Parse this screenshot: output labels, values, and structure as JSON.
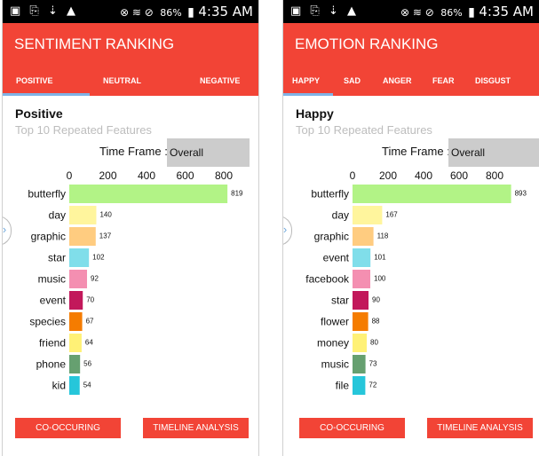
{
  "status_bar": {
    "left_icons": "▣ ⎘ ⇣ ▲",
    "right_icons": "⊗ ≋ ⊘",
    "battery": "86%",
    "time": "4:35 AM"
  },
  "left": {
    "app_title": "SENTIMENT RANKING",
    "tabs": [
      {
        "label": "POSITIVE",
        "selected": true
      },
      {
        "label": "NEUTRAL",
        "selected": false
      },
      {
        "label": "NEGATIVE",
        "selected": false
      }
    ],
    "section_title": "Positive",
    "section_subtitle": "Top 10 Repeated Features",
    "time_frame_label": "Time Frame :",
    "time_frame_value": "Overall",
    "buttons": {
      "co_occuring": "CO-OCCURING",
      "timeline": "TIMELINE ANALYSIS"
    }
  },
  "right": {
    "app_title": "EMOTION RANKING",
    "tabs": [
      {
        "label": "HAPPY",
        "selected": true
      },
      {
        "label": "SAD",
        "selected": false
      },
      {
        "label": "ANGER",
        "selected": false
      },
      {
        "label": "FEAR",
        "selected": false
      },
      {
        "label": "DISGUST",
        "selected": false
      }
    ],
    "section_title": "Happy",
    "section_subtitle": "Top 10 Repeated Features",
    "time_frame_label": "Time Frame :",
    "time_frame_value": "Overall",
    "buttons": {
      "co_occuring": "CO-OCCURING",
      "timeline": "TIMELINE ANALYSIS"
    }
  },
  "chart_data": [
    {
      "type": "bar",
      "orientation": "horizontal",
      "title": "",
      "xlim": [
        0,
        900
      ],
      "ticks": [
        0,
        200,
        400,
        600,
        800
      ],
      "categories": [
        "butterfly",
        "day",
        "graphic",
        "star",
        "music",
        "event",
        "species",
        "friend",
        "phone",
        "kid"
      ],
      "values": [
        819,
        140,
        137,
        102,
        92,
        70,
        67,
        64,
        56,
        54
      ],
      "colors": [
        "#b2f386",
        "#fff59d",
        "#ffcc80",
        "#80deea",
        "#f48fb1",
        "#c2185b",
        "#f57c00",
        "#fff176",
        "#66a070",
        "#26c6da"
      ]
    },
    {
      "type": "bar",
      "orientation": "horizontal",
      "title": "",
      "xlim": [
        0,
        900
      ],
      "ticks": [
        0,
        200,
        400,
        600,
        800
      ],
      "categories": [
        "butterfly",
        "day",
        "graphic",
        "event",
        "facebook",
        "star",
        "flower",
        "money",
        "music",
        "file"
      ],
      "values": [
        893,
        167,
        118,
        101,
        100,
        90,
        88,
        80,
        73,
        72
      ],
      "colors": [
        "#b2f386",
        "#fff59d",
        "#ffcc80",
        "#80deea",
        "#f48fb1",
        "#c2185b",
        "#f57c00",
        "#fff176",
        "#66a070",
        "#26c6da"
      ]
    }
  ]
}
